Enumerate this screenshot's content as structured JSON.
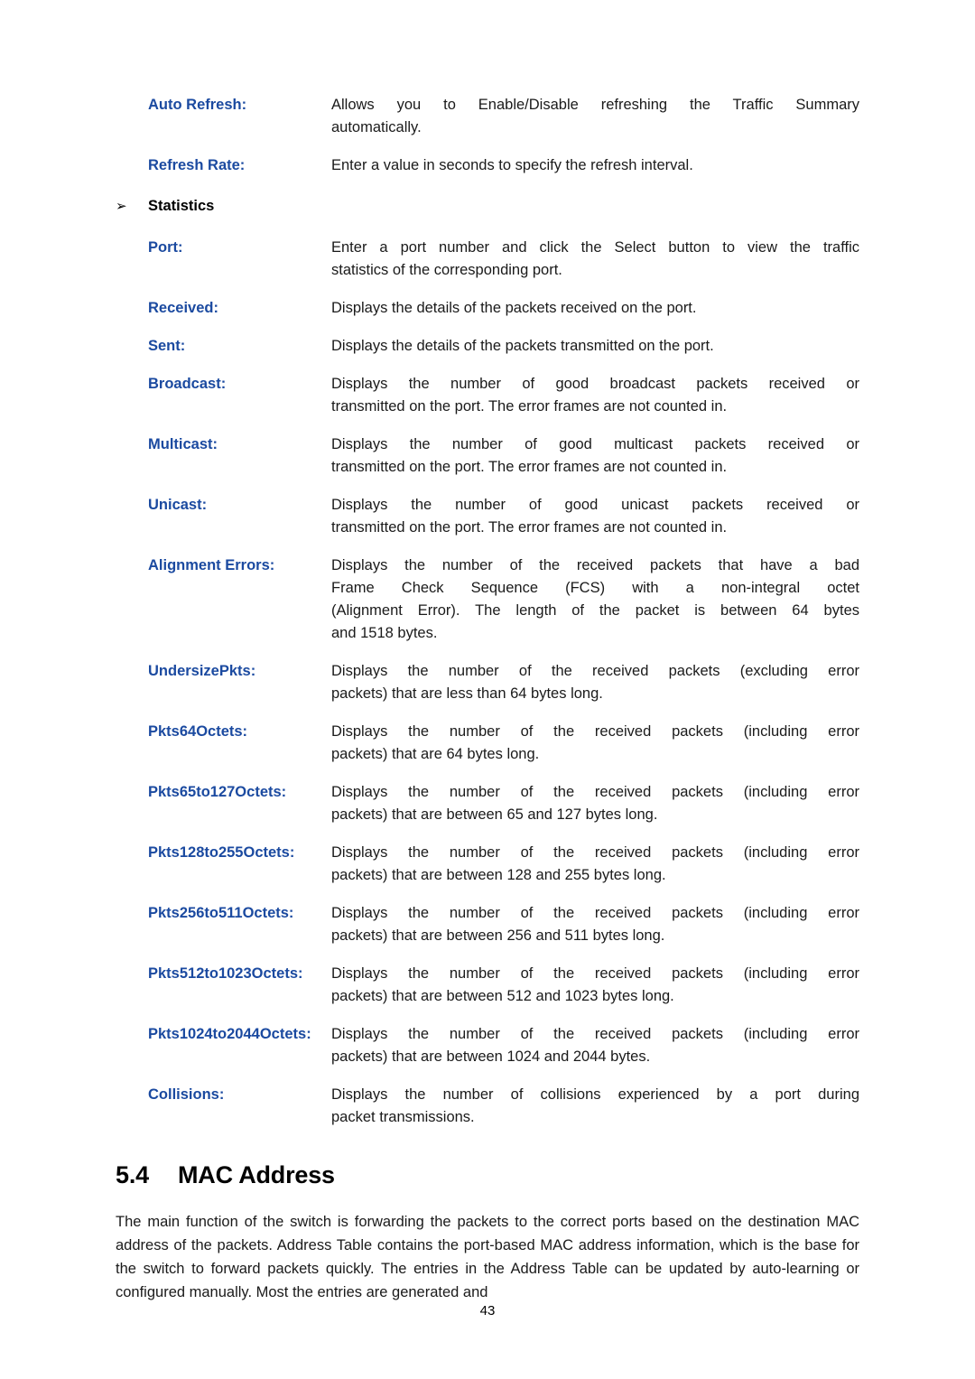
{
  "page": {
    "number": "43"
  },
  "definitions_top": [
    {
      "term": "Auto Refresh:",
      "lines": [
        "Allows you to Enable/Disable refreshing the Traffic Summary",
        "automatically."
      ]
    },
    {
      "term": "Refresh Rate:",
      "lines": [
        "Enter a value in seconds to specify the refresh interval."
      ]
    }
  ],
  "bullet_heading": {
    "marker": "right-triangle-bullet",
    "marker_glyph": "➢",
    "label": "Statistics"
  },
  "definitions_statistics": [
    {
      "term": "Port:",
      "lines": [
        "Enter a port number and click the Select button to view the traffic",
        "statistics of the corresponding port."
      ]
    },
    {
      "term": "Received:",
      "lines": [
        "Displays the details of the packets received on the port."
      ]
    },
    {
      "term": "Sent:",
      "lines": [
        "Displays the details of the packets transmitted on the port."
      ]
    },
    {
      "term": "Broadcast:",
      "lines": [
        "Displays the number of good broadcast packets received or",
        "transmitted on the port. The error frames are not counted in."
      ]
    },
    {
      "term": "Multicast:",
      "lines": [
        "Displays the number of good multicast packets received or",
        "transmitted on the port. The error frames are not counted in."
      ]
    },
    {
      "term": "Unicast:",
      "lines": [
        "Displays the number of good unicast packets received or",
        "transmitted on the port. The error frames are not counted in."
      ]
    },
    {
      "term": "Alignment Errors:",
      "lines": [
        "Displays the number of the received packets that have a bad",
        "Frame Check Sequence (FCS) with a non-integral octet",
        "(Alignment Error). The length of the packet is between 64 bytes",
        "and 1518 bytes."
      ]
    },
    {
      "term": "UndersizePkts:",
      "lines": [
        "Displays the number of the received packets (excluding error",
        "packets) that are less than 64 bytes long."
      ]
    },
    {
      "term": "Pkts64Octets:",
      "lines": [
        "Displays the number of the received packets (including error",
        "packets) that are 64 bytes long."
      ]
    },
    {
      "term": "Pkts65to127Octets:",
      "lines": [
        "Displays the number of the received packets (including error",
        "packets) that are between 65 and 127 bytes long."
      ]
    },
    {
      "term": "Pkts128to255Octets:",
      "lines": [
        "Displays the number of the received packets (including error",
        "packets) that are between 128 and 255 bytes long."
      ]
    },
    {
      "term": "Pkts256to511Octets:",
      "lines": [
        "Displays the number of the received packets (including error",
        "packets) that are between 256 and 511 bytes long."
      ]
    },
    {
      "term": "Pkts512to1023Octets:",
      "lines": [
        "Displays the number of the received packets (including error",
        "packets) that are between 512 and 1023 bytes long."
      ]
    },
    {
      "term": "Pkts1024to2044Octets:",
      "lines": [
        "Displays the number of the received packets (including error",
        "packets) that are between 1024 and 2044 bytes."
      ]
    },
    {
      "term": "Collisions:",
      "lines": [
        "Displays the number of collisions experienced by a port during",
        "packet transmissions."
      ]
    }
  ],
  "section": {
    "number": "5.4",
    "title": "MAC Address",
    "paragraph": "The main function of the switch is forwarding the packets to the correct ports based on the destination MAC address of the packets. Address Table contains the port-based MAC address information, which is the base for the switch to forward packets quickly. The entries in the Address Table can be updated by auto-learning or configured manually. Most the entries are generated and"
  },
  "colors": {
    "term_blue": "#1b4aa0",
    "body_black": "#1a1a1a",
    "background": "#ffffff"
  }
}
